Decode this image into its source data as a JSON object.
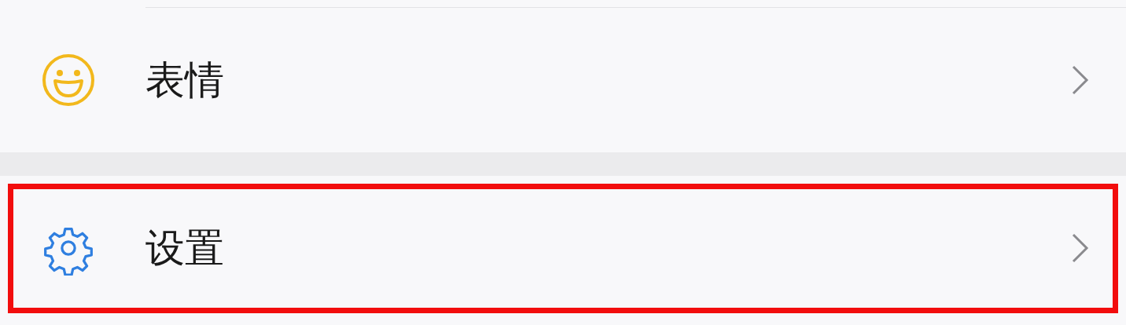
{
  "groups": [
    {
      "items": [
        {
          "kind": "emoji",
          "label": "表情",
          "highlighted": false
        }
      ]
    },
    {
      "items": [
        {
          "kind": "settings",
          "label": "设置",
          "highlighted": true
        }
      ]
    }
  ]
}
